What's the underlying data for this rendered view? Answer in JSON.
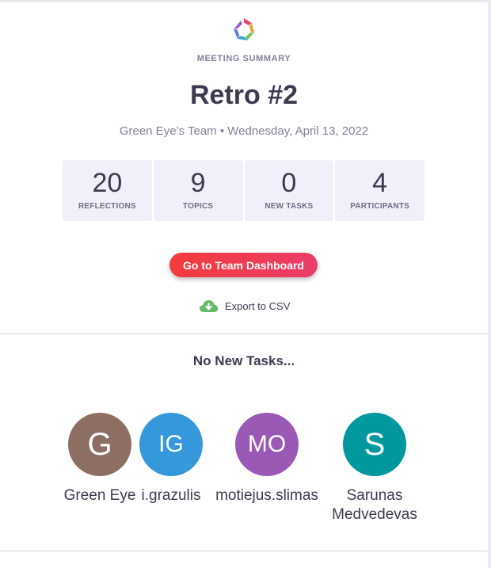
{
  "header": {
    "eyebrow": "MEETING SUMMARY",
    "title": "Retro #2",
    "subtitle": "Green Eye’s Team • Wednesday, April 13, 2022"
  },
  "stats": [
    {
      "value": "20",
      "label": "REFLECTIONS"
    },
    {
      "value": "9",
      "label": "TOPICS"
    },
    {
      "value": "0",
      "label": "NEW TASKS"
    },
    {
      "value": "4",
      "label": "PARTICIPANTS"
    }
  ],
  "actions": {
    "dashboard_label": "Go to Team Dashboard",
    "export_label": "Export to CSV",
    "export_icon": "cloud-download-icon"
  },
  "tasks": {
    "heading": "No New Tasks..."
  },
  "participants": [
    {
      "initials": "G",
      "name": "Green Eye",
      "color": "#8d6e63"
    },
    {
      "initials": "IG",
      "name": "i.grazulis",
      "color": "#3498db"
    },
    {
      "initials": "MO",
      "name": "motiejus.slimas",
      "color": "#9b59b6"
    },
    {
      "initials": "S",
      "name": "Sarunas Medvedevas",
      "color": "#00979d"
    }
  ],
  "colors": {
    "accent_red": "#f23b3b",
    "accent_pink": "#ec3d6c",
    "stat_bg": "#f1f0fa",
    "text_dark": "#3d3a50",
    "text_muted": "#82809a"
  }
}
